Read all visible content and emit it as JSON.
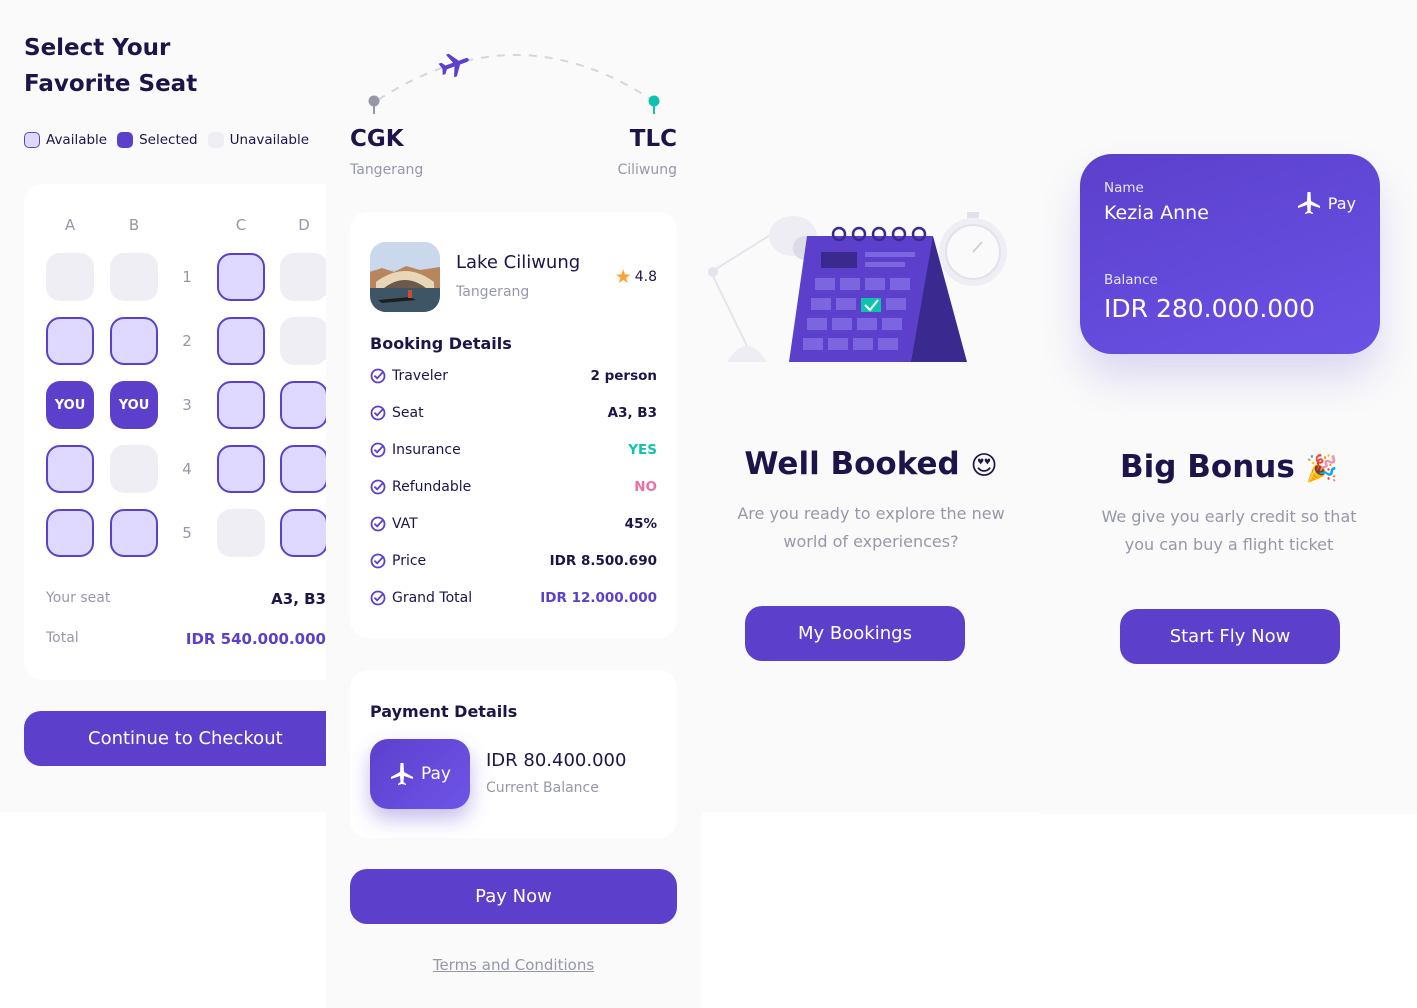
{
  "seat_screen": {
    "title_line1": "Select Your",
    "title_line2": "Favorite Seat",
    "legend": {
      "available": "Available",
      "selected": "Selected",
      "unavailable": "Unavailable"
    },
    "columns": [
      "A",
      "B",
      "C",
      "D"
    ],
    "rows": [
      "1",
      "2",
      "3",
      "4",
      "5"
    ],
    "you_label": "YOU",
    "your_seat_label": "Your seat",
    "your_seat_value": "A3, B3",
    "total_label": "Total",
    "total_value": "IDR 540.000.000",
    "continue_label": "Continue to Checkout"
  },
  "checkout_screen": {
    "from_code": "CGK",
    "from_city": "Tangerang",
    "to_code": "TLC",
    "to_city": "Ciliwung",
    "destination": "Lake Ciliwung",
    "destination_city": "Tangerang",
    "rating": "4.8",
    "booking_title": "Booking Details",
    "details": [
      {
        "label": "Traveler",
        "value": "2 person",
        "color": "#1F1449"
      },
      {
        "label": "Seat",
        "value": "A3, B3",
        "color": "#1F1449"
      },
      {
        "label": "Insurance",
        "value": "YES",
        "color": "#0EC3AE"
      },
      {
        "label": "Refundable",
        "value": "NO",
        "color": "#EB70A5"
      },
      {
        "label": "VAT",
        "value": "45%",
        "color": "#1F1449"
      },
      {
        "label": "Price",
        "value": "IDR 8.500.690",
        "color": "#1F1449"
      },
      {
        "label": "Grand Total",
        "value": "IDR 12.000.000",
        "color": "#5C40CC"
      }
    ],
    "payment_title": "Payment Details",
    "pay_chip_label": "Pay",
    "balance": "IDR 80.400.000",
    "balance_label": "Current Balance",
    "pay_now_label": "Pay Now",
    "terms_label": "Terms and Conditions"
  },
  "success_screen": {
    "title": "Well Booked",
    "emoji": "😍",
    "subtitle_line1": "Are you ready to explore the new",
    "subtitle_line2": "world of experiences?",
    "button_label": "My Bookings"
  },
  "bonus_screen": {
    "name_label": "Name",
    "name": "Kezia Anne",
    "pay_label": "Pay",
    "balance_label": "Balance",
    "balance": "IDR 280.000.000",
    "title": "Big Bonus",
    "emoji": "🎉",
    "subtitle_line1": "We give you early credit so that",
    "subtitle_line2": "you can buy a flight ticket",
    "button_label": "Start Fly Now"
  },
  "colors": {
    "primary": "#5C40CC",
    "dark_text": "#1F1449",
    "grey_text": "#9698A9",
    "available_fill": "#E0D9FF",
    "unavailable_fill": "#EEEEF4",
    "green": "#0EC3AE",
    "red": "#EB70A5",
    "star": "#FFA235"
  }
}
